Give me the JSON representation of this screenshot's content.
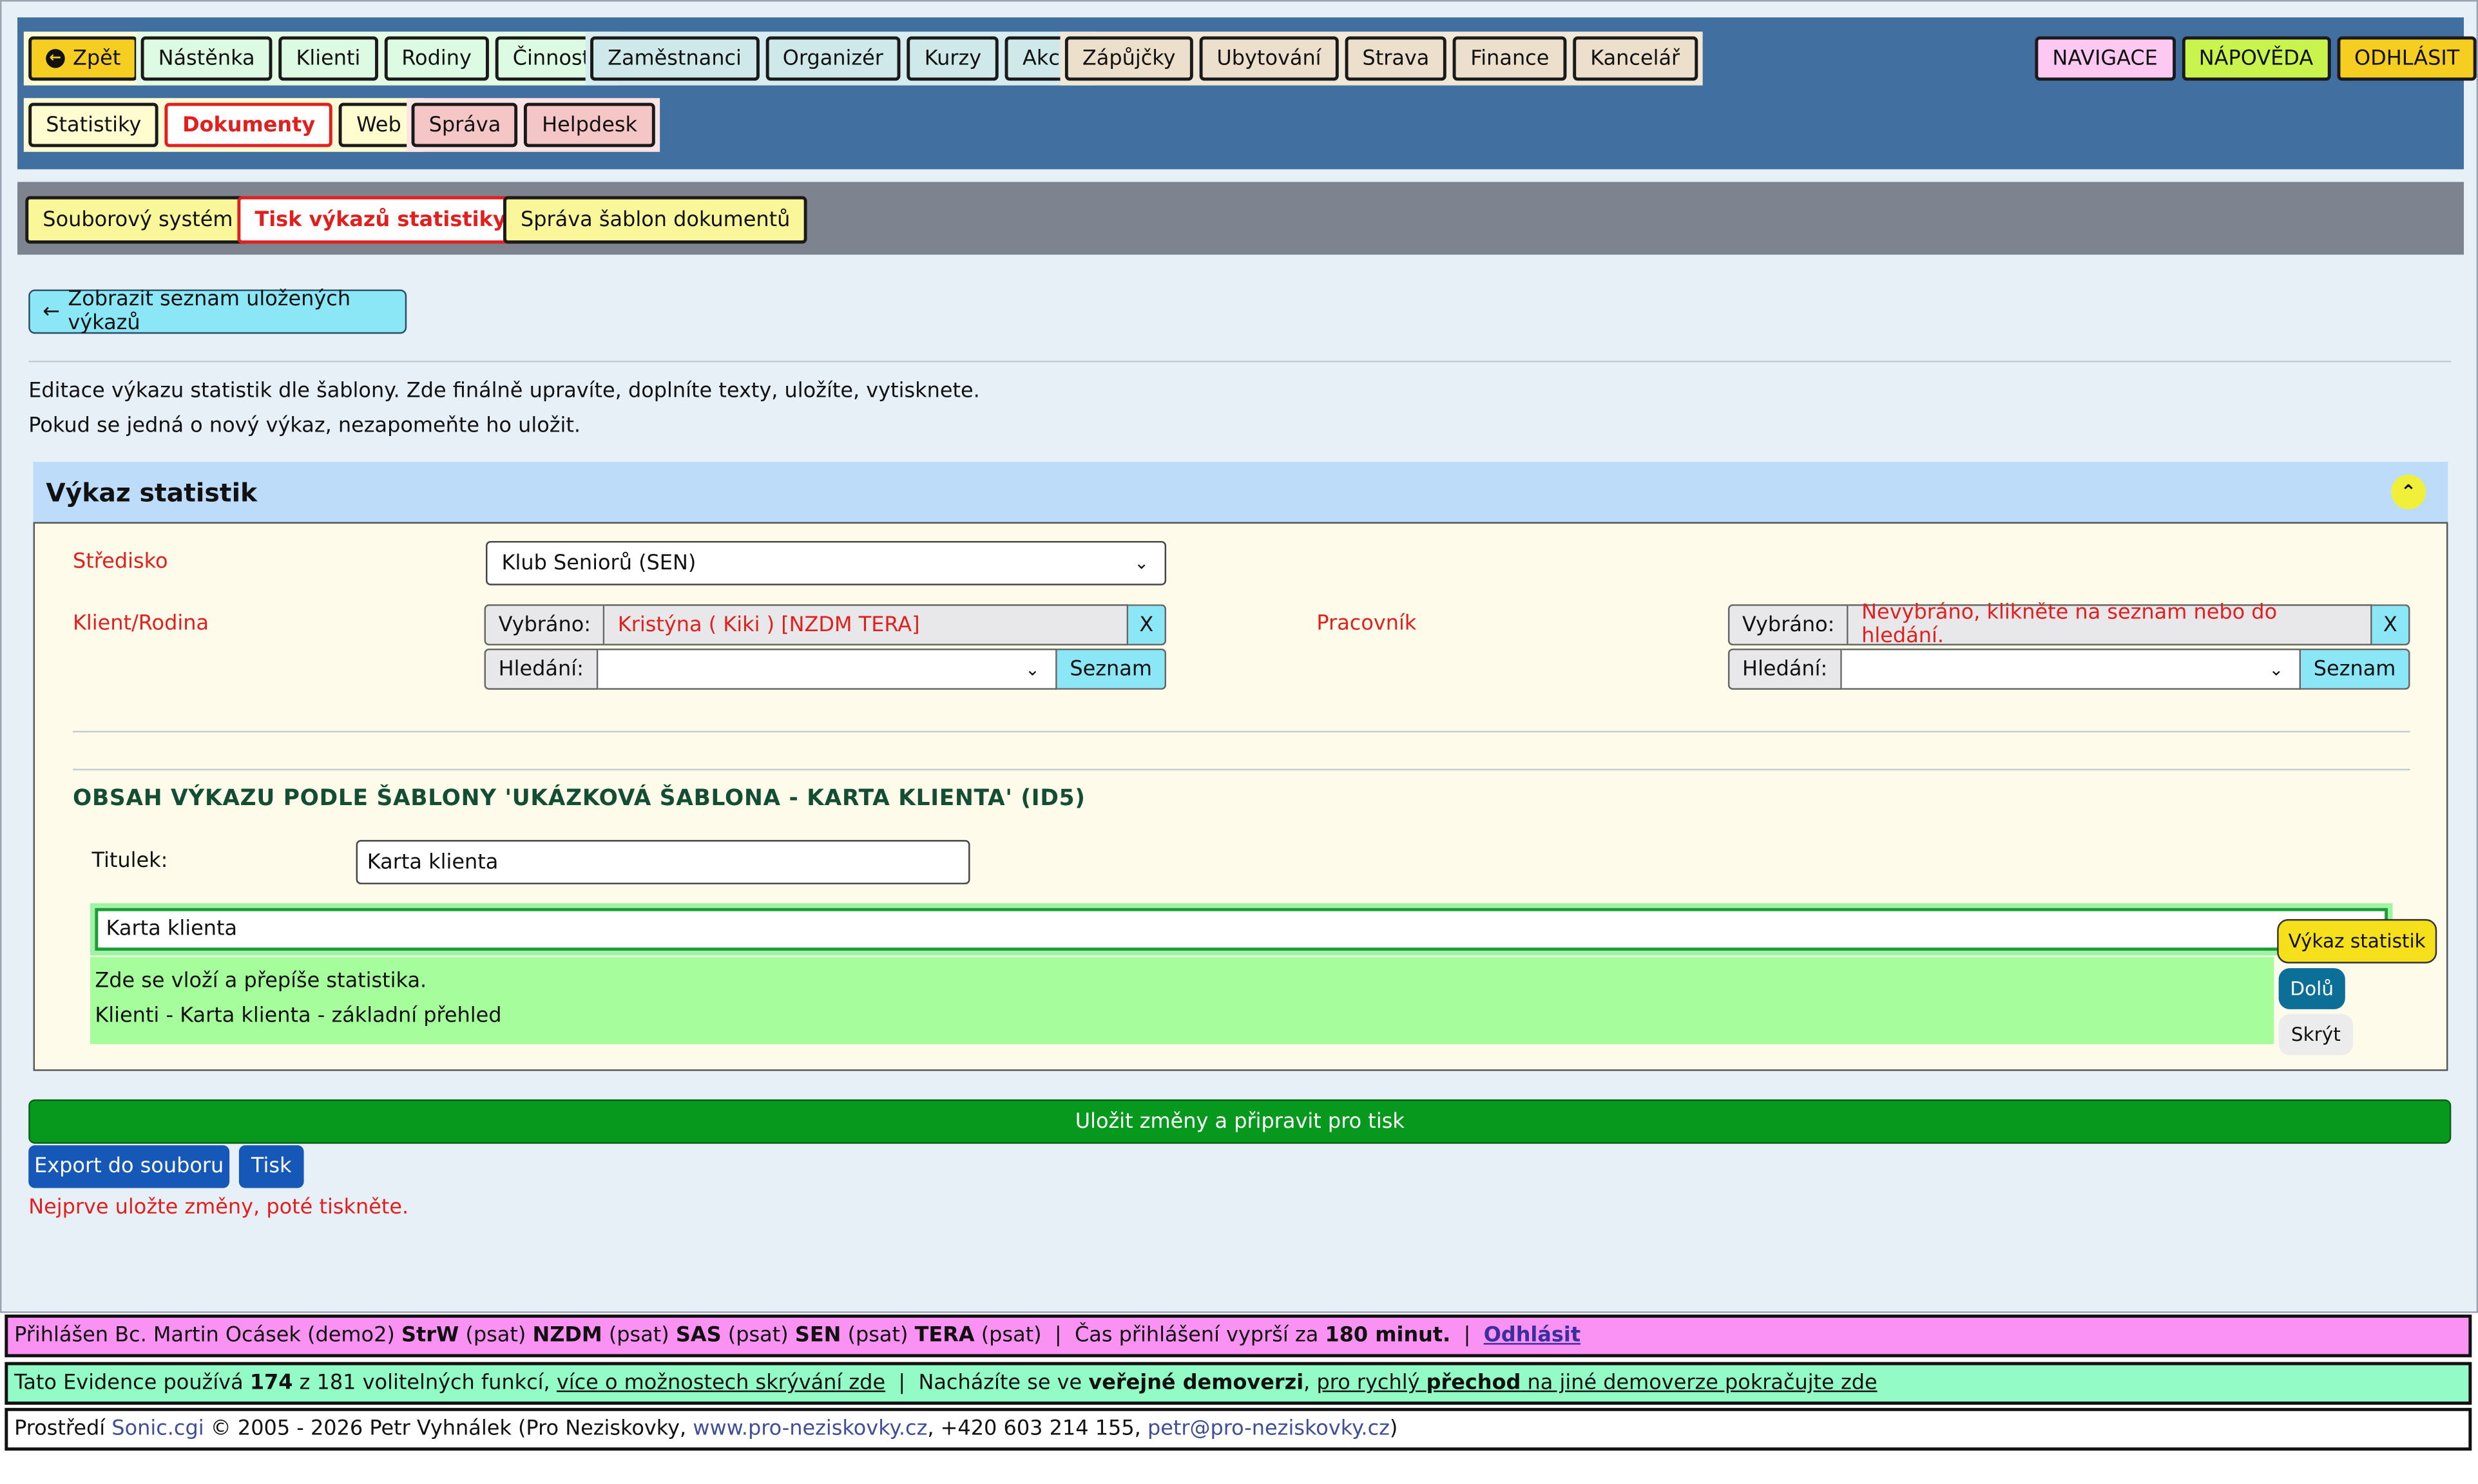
{
  "nav": {
    "back": "Zpět",
    "group1": [
      "Nástěnka",
      "Klienti",
      "Rodiny",
      "Činnosti"
    ],
    "group2": [
      "Zaměstnanci",
      "Organizér",
      "Kurzy",
      "Akce"
    ],
    "group3": [
      "Zápůjčky",
      "Ubytování",
      "Strava",
      "Finance",
      "Kancelář"
    ],
    "group4": [
      "Statistiky",
      "Dokumenty",
      "Web"
    ],
    "group5": [
      "Správa",
      "Helpdesk"
    ],
    "navigace": "NAVIGACE",
    "napoveda": "NÁPOVĚDA",
    "odhlasit": "ODHLÁSIT"
  },
  "subnav": [
    "Souborový systém",
    "Tisk výkazů statistiky",
    "Správa šablon dokumentů"
  ],
  "back_button": "Zobrazit seznam uložených výkazů",
  "intro": [
    "Editace výkazu statistik dle šablony. Zde finálně upravíte, doplníte texty, uložíte, vytisknete.",
    "Pokud se jedná o nový výkaz, nezapomeňte ho uložit."
  ],
  "panel": {
    "title": "Výkaz statistik",
    "stredisko_label": "Středisko",
    "stredisko_value": "Klub Seniorů (SEN)",
    "klient_label": "Klient/Rodina",
    "klient_selected_label": "Vybráno:",
    "klient_selected_value": "Kristýna ( Kiki ) [NZDM TERA]",
    "klient_clear": "X",
    "klient_search_label": "Hledání:",
    "klient_list_button": "Seznam",
    "pracovnik_label": "Pracovník",
    "pracovnik_selected_label": "Vybráno:",
    "pracovnik_selected_value": "Nevybráno, klikněte na seznam nebo do hledání.",
    "pracovnik_clear": "X",
    "pracovnik_search_label": "Hledání:",
    "pracovnik_list_button": "Seznam",
    "section_title": "OBSAH VÝKAZU PODLE ŠABLONY 'UKÁZKOVÁ ŠABLONA - KARTA KLIENTA' (ID5)",
    "titulek_label": "Titulek:",
    "titulek_value": "Karta klienta",
    "editor_heading": "Karta klienta",
    "editor_line1": "Zde se vloží a přepíše statistika.",
    "editor_line2": "Klienti - Karta klienta - základní přehled",
    "side_vykaz": "Výkaz statistik",
    "side_dolu": "Dolů",
    "side_skryt": "Skrýt"
  },
  "actions": {
    "save": "Uložit změny a připravit pro tisk",
    "export": "Export do souboru",
    "print": "Tisk",
    "warning": "Nejprve uložte změny, poté tiskněte."
  },
  "footer": {
    "line1_prefix": "Přihlášen Bc. Martin Ocásek (demo2)",
    "line1_roles": [
      {
        "code": "StrW",
        "perm": "(psat)"
      },
      {
        "code": "NZDM",
        "perm": "(psat)"
      },
      {
        "code": "SAS",
        "perm": "(psat)"
      },
      {
        "code": "SEN",
        "perm": "(psat)"
      },
      {
        "code": "TERA",
        "perm": "(psat)"
      }
    ],
    "line1_sep1": "|",
    "line1_time_prefix": "Čas přihlášení vyprší za",
    "line1_time_value": "180 minut.",
    "line1_sep2": "|",
    "line1_logout": "Odhlásit",
    "line2_prefix": "Tato Evidence používá",
    "line2_used": "174",
    "line2_total": "z 181 volitelných funkcí,",
    "line2_link": "více o možnostech skrývání zde",
    "line2_sep": "|",
    "line2_mid": "Nacházíte se ve",
    "line2_bold": "veřejné demoverzi",
    "line2_comma": ",",
    "line2_link2_a": "pro rychlý",
    "line2_link2_b": "přechod",
    "line2_link2_c": "na jiné demoverze pokračujte zde",
    "line3_prefix": "Prostředí",
    "line3_sonic": "Sonic.cgi",
    "line3_copy": "© 2005 - 2026 Petr Vyhnálek (Pro Neziskovky,",
    "line3_web": "www.pro-neziskovky.cz",
    "line3_phone": ", +420 603 214 155,",
    "line3_mail": "petr@pro-neziskovky.cz",
    "line3_end": ")"
  },
  "colors": {
    "nav_bg": "#416f9f",
    "subnav_bg": "#7e8390",
    "active_red": "#e0201e",
    "save_green": "#07991e",
    "btn_blue": "#1658b8",
    "cyan": "#8be6f6"
  }
}
